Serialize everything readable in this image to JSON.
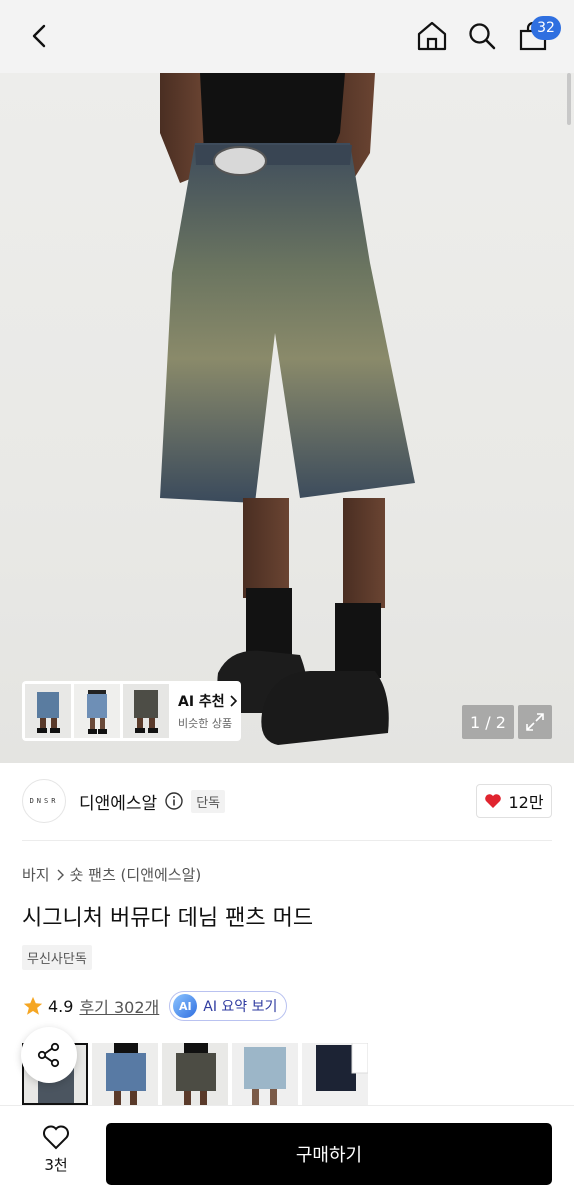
{
  "header": {
    "cart_count": "32",
    "icons": [
      "chevron-left-icon",
      "home-icon",
      "search-icon",
      "shopping-bag-icon"
    ]
  },
  "hero": {
    "ai_recommend": {
      "title": "AI 추천",
      "subtitle": "비슷한 상품"
    },
    "pager": "1 / 2"
  },
  "brand": {
    "logo_text": "DNSR",
    "name": "디앤에스알",
    "exclusive_tag": "단독",
    "like_count": "12만"
  },
  "product": {
    "breadcrumb": [
      "바지",
      "숏 팬츠 (디앤에스알)"
    ],
    "title": "시그니처 버뮤다 데님 팬츠 머드",
    "tag": "무신사단독",
    "rating": "4.9",
    "reviews": "후기 302개",
    "ai_summary_label": "AI 요약 보기",
    "ai_badge": "AI"
  },
  "bottom": {
    "wish_count": "3천",
    "buy_label": "구매하기"
  },
  "colors": {
    "accent": "#2f6fe0",
    "heart": "#e0242f",
    "star": "#f5a623"
  }
}
